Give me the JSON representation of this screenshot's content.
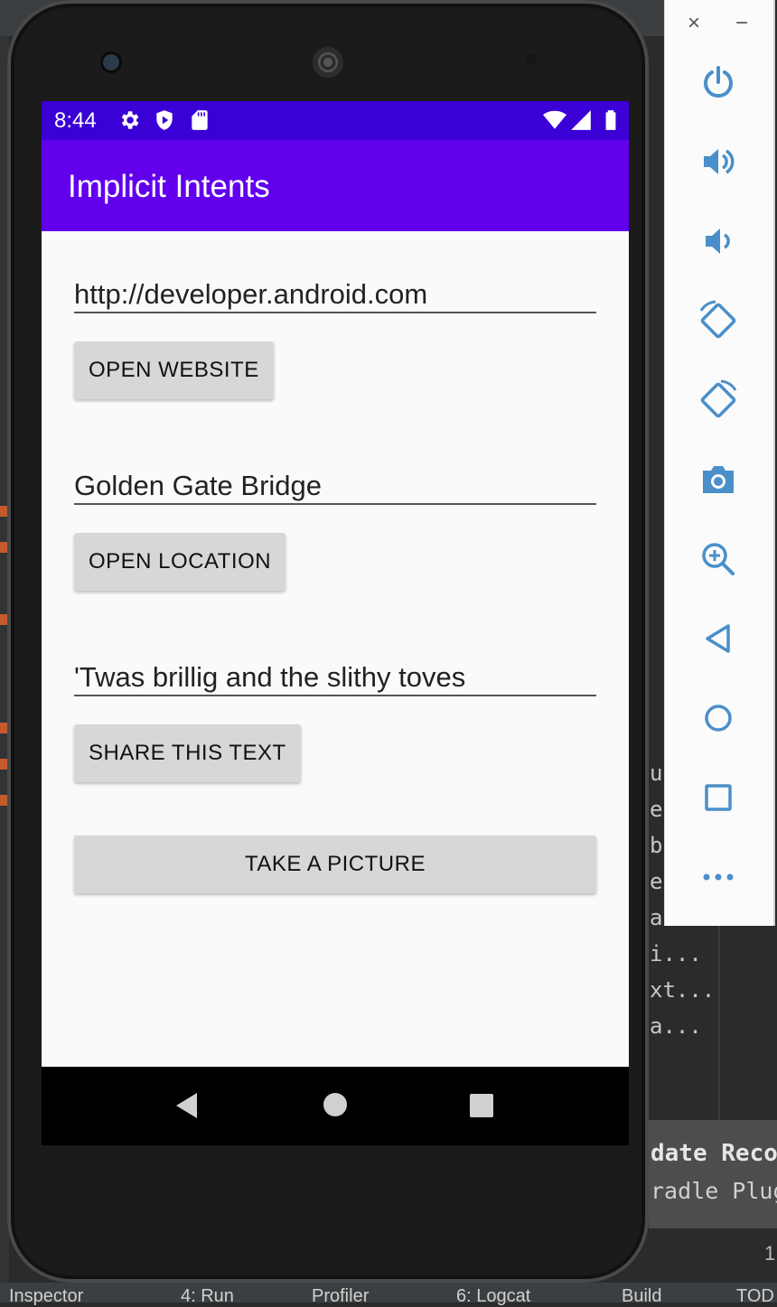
{
  "ide": {
    "snippets": [
      "ut",
      "e",
      "b",
      "e",
      "a",
      "i...",
      "xt...",
      "a..."
    ],
    "notice_title": "date Reco",
    "notice_sub": "radle Plugi",
    "page_number": "1",
    "bottom_items": [
      "Inspector",
      "4: Run",
      "Profiler",
      "6: Logcat",
      "Build",
      "TOD"
    ]
  },
  "status_bar": {
    "time": "8:44",
    "icons": [
      "settings-icon",
      "shield-icon",
      "sd-card-icon",
      "wifi-icon",
      "signal-icon",
      "battery-icon"
    ]
  },
  "app_bar": {
    "title": "Implicit Intents"
  },
  "main": {
    "website_field_value": "http://developer.android.com",
    "open_website_label": "OPEN WEBSITE",
    "location_field_value": "Golden Gate Bridge",
    "open_location_label": "OPEN LOCATION",
    "share_field_value": "'Twas brillig and the slithy toves",
    "share_label": "SHARE THIS TEXT",
    "take_picture_label": "TAKE A PICTURE"
  },
  "nav_bar": {
    "icons": [
      "back-icon",
      "home-icon",
      "overview-icon"
    ]
  },
  "emulator_panel": {
    "close": "×",
    "minimize": "−",
    "buttons": [
      "power-icon",
      "volume-up-icon",
      "volume-down-icon",
      "rotate-left-icon",
      "rotate-right-icon",
      "camera-icon",
      "zoom-icon",
      "back-icon",
      "home-icon",
      "overview-icon",
      "more-icon"
    ]
  },
  "colors": {
    "status_bar": "#3a00d6",
    "app_bar": "#6200ee",
    "button": "#d6d7d7",
    "screen_bg": "#fafafa",
    "panel_icon": "#4a8fc9"
  }
}
